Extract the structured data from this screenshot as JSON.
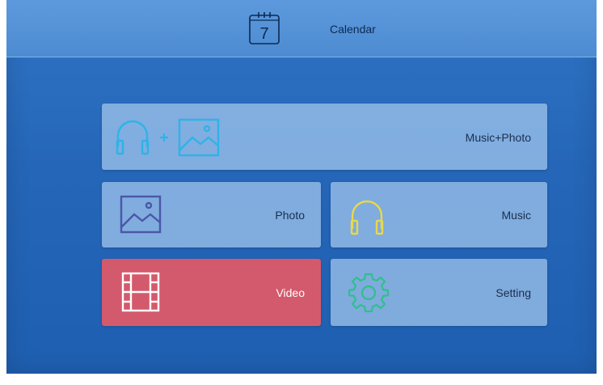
{
  "header": {
    "calendar_icon": "calendar-icon",
    "calendar_day": "7",
    "title": "Calendar"
  },
  "tiles": {
    "music_photo": {
      "label": "Music+Photo",
      "icons": [
        "headphones-icon",
        "plus-icon",
        "image-icon"
      ],
      "icon_color": "#2fb3e8"
    },
    "photo": {
      "label": "Photo",
      "icon": "image-icon",
      "icon_color": "#4a57a8"
    },
    "music": {
      "label": "Music",
      "icon": "headphones-icon",
      "icon_color": "#e8d84a"
    },
    "video": {
      "label": "Video",
      "icon": "film-icon",
      "icon_color": "#ffffff",
      "selected": true
    },
    "setting": {
      "label": "Setting",
      "icon": "gear-icon",
      "icon_color": "#2fbf8c"
    }
  },
  "colors": {
    "background": "#2566b8",
    "header": "#5294d8",
    "tile": "#b9d9f7",
    "selected_tile": "#d35a6c"
  }
}
